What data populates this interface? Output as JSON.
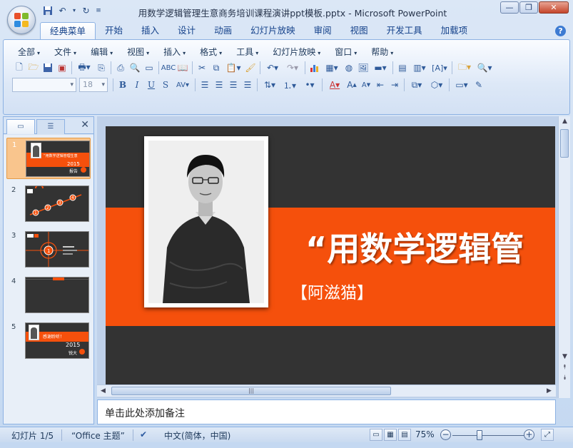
{
  "window": {
    "title": "用数学逻辑管理生意商务培训课程演讲ppt模板.pptx - Microsoft PowerPoint",
    "controls": [
      "minimize-icon",
      "restore-icon",
      "close-icon"
    ]
  },
  "quick_access": [
    "save-icon",
    "undo-icon",
    "redo-icon",
    "customize-icon"
  ],
  "ribbon_tabs": [
    "经典菜单",
    "开始",
    "插入",
    "设计",
    "动画",
    "幻灯片放映",
    "审阅",
    "视图",
    "开发工具",
    "加载项"
  ],
  "active_tab": "经典菜单",
  "menus": [
    "全部",
    "文件",
    "编辑",
    "视图",
    "插入",
    "格式",
    "工具",
    "幻灯片放映",
    "窗口",
    "帮助"
  ],
  "font": {
    "name": "",
    "size": "18"
  },
  "slides": [
    {
      "num": "1",
      "title": "“用数学逻辑管理生意",
      "year": "2015",
      "sub": "报告"
    },
    {
      "num": "2",
      "steps": [
        "1",
        "2",
        "3",
        "4"
      ]
    },
    {
      "num": "3",
      "label": "1"
    },
    {
      "num": "4"
    },
    {
      "num": "5",
      "title": "感谢聆听！",
      "year": "2015",
      "sub": "锐大"
    }
  ],
  "current_slide": {
    "title": "“用数学逻辑管",
    "subtitle": "【阿滋猫】"
  },
  "notes_placeholder": "单击此处添加备注",
  "status": {
    "slide_counter": "幻灯片 1/5",
    "theme": "“Office 主题”",
    "language": "中文(简体，中国)",
    "zoom": "75%"
  },
  "colors": {
    "accent": "#f5500c",
    "slide_bg": "#333333",
    "ribbon": "#dbe7f6"
  }
}
